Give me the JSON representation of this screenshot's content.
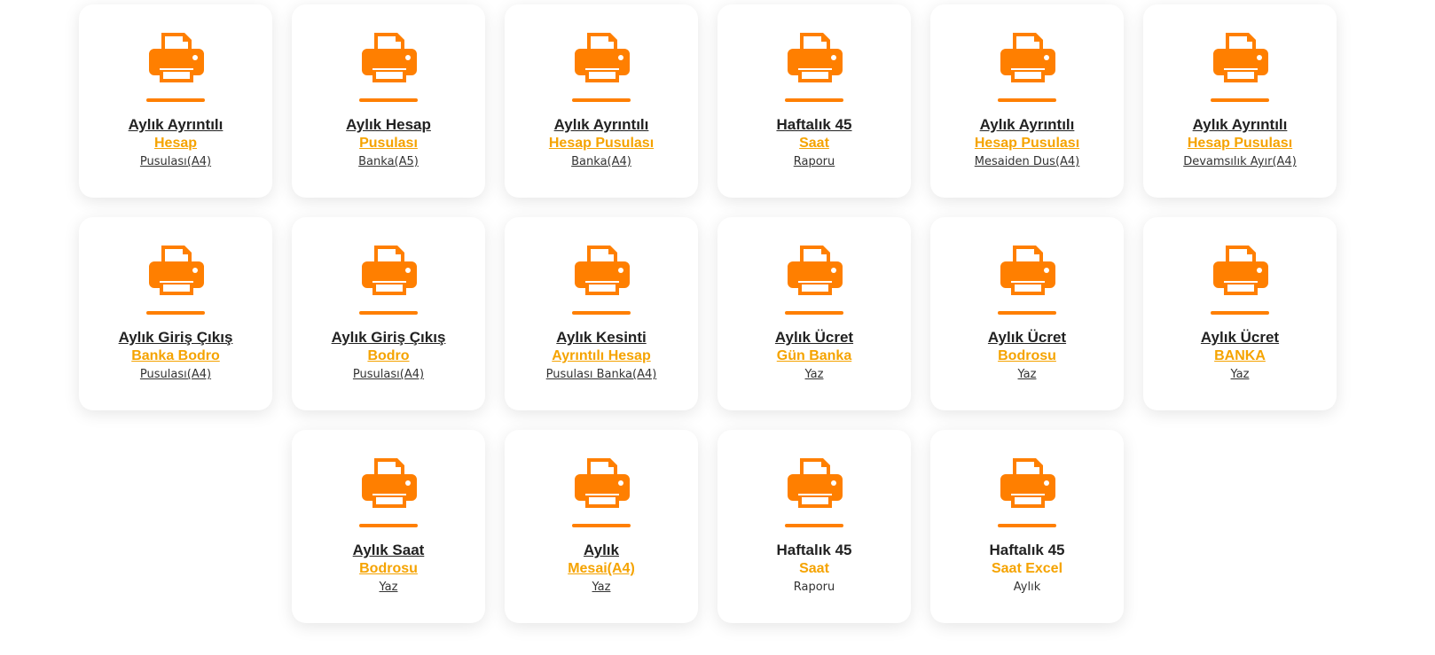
{
  "cards": [
    {
      "line1": "Aylık Ayrıntılı",
      "line2": "Hesap",
      "line3": "Pusulası(A4)",
      "icon": "printer-icon",
      "linked": true
    },
    {
      "line1": "Aylık Hesap",
      "line2": "Pusulası",
      "line3": "Banka(A5)",
      "icon": "printer-icon",
      "linked": true
    },
    {
      "line1": "Aylık Ayrıntılı",
      "line2": "Hesap Pusulası",
      "line3": "Banka(A4)",
      "icon": "printer-icon",
      "linked": true
    },
    {
      "line1": "Haftalık 45",
      "line2": "Saat",
      "line3": "Raporu",
      "icon": "printer-icon",
      "linked": true
    },
    {
      "line1": "Aylık Ayrıntılı",
      "line2": "Hesap Pusulası",
      "line3": "Mesaiden Dus(A4)",
      "icon": "printer-icon",
      "linked": true
    },
    {
      "line1": "Aylık Ayrıntılı",
      "line2": "Hesap Pusulası",
      "line3": "Devamsılık Ayır(A4)",
      "icon": "printer-icon",
      "linked": true
    },
    {
      "line1": "Aylık Giriş Çıkış",
      "line2": "Banka Bodro",
      "line3": "Pusulası(A4)",
      "icon": "printer-icon",
      "linked": true
    },
    {
      "line1": "Aylık Giriş Çıkış",
      "line2": "Bodro",
      "line3": "Pusulası(A4)",
      "icon": "printer-icon",
      "linked": true
    },
    {
      "line1": "Aylık Kesinti",
      "line2": "Ayrıntılı Hesap",
      "line3": "Pusulası Banka(A4)",
      "icon": "printer-icon",
      "linked": true
    },
    {
      "line1": "Aylık Ücret",
      "line2": "Gün Banka",
      "line3": "Yaz",
      "icon": "printer-icon",
      "linked": true
    },
    {
      "line1": "Aylık Ücret",
      "line2": "Bodrosu",
      "line3": "Yaz",
      "icon": "printer-icon",
      "linked": true
    },
    {
      "line1": "Aylık Ücret",
      "line2": "BANKA",
      "line3": "Yaz",
      "icon": "printer-icon",
      "linked": true
    },
    {
      "line1": "Aylık Saat",
      "line2": "Bodrosu",
      "line3": "Yaz",
      "icon": "printer-icon",
      "linked": true
    },
    {
      "line1": "Aylık",
      "line2": "Mesai(A4)",
      "line3": "Yaz",
      "icon": "printer-icon",
      "linked": true
    },
    {
      "line1": "Haftalık 45",
      "line2": "Saat",
      "line3": "Raporu",
      "icon": "printer-icon",
      "linked": false
    },
    {
      "line1": "Haftalık 45",
      "line2": "Saat Excel",
      "line3": "Aylık",
      "icon": "printer-icon",
      "linked": false
    }
  ],
  "colors": {
    "accent": "#ff7f00",
    "subtitle": "#f5a300",
    "title": "#222222"
  }
}
